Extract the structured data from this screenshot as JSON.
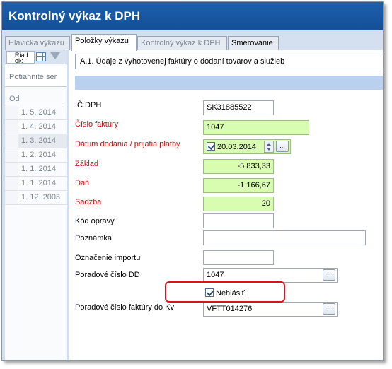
{
  "window": {
    "title": "Kontrolný výkaz k DPH"
  },
  "tabs": [
    {
      "label": "Hlavička výkazu"
    },
    {
      "label": "Položky výkazu"
    },
    {
      "label": "Kontrolný výkaz k DPH"
    },
    {
      "label": "Smerovanie"
    }
  ],
  "left_panel": {
    "row_button_label": "Riad\nok:",
    "grid_icon": "grid-icon",
    "filter_icon": "filter-icon",
    "drag_hint": "Potiahnite ser",
    "column_header": "Od",
    "rows": [
      "1. 5. 2014",
      "1. 4. 2014",
      "1. 3. 2014",
      "1. 2. 2014",
      "1. 1. 2014",
      "1. 1. 2014",
      "1. 12. 2003"
    ],
    "selected_row": 2
  },
  "form": {
    "section": "A.1. Údaje z vyhotovenej faktúry o dodaní tovarov a služieb",
    "fields": {
      "ic_dph": {
        "label": "IČ DPH",
        "value": "SK31885522"
      },
      "cislo_faktury": {
        "label": "Číslo faktúry",
        "value": "1047"
      },
      "datum": {
        "label": "Dátum dodania / prijatia platby",
        "value": "20.03.2014",
        "checked": true
      },
      "zaklad": {
        "label": "Základ",
        "value": "-5 833,33"
      },
      "dan": {
        "label": "Daň",
        "value": "-1 166,67"
      },
      "sadzba": {
        "label": "Sadzba",
        "value": "20"
      },
      "kod_opravy": {
        "label": "Kód opravy",
        "value": ""
      },
      "poznamka": {
        "label": "Poznámka",
        "value": ""
      },
      "oznacenie_importu": {
        "label": "Označenie importu",
        "value": ""
      },
      "poradove_dd": {
        "label": "Poradové číslo DD",
        "value": "1047"
      },
      "nehlasit": {
        "label": "Nehlásiť",
        "checked": true
      },
      "poradove_faktury_kv": {
        "label": "Poradové číslo faktúry do Kv",
        "value": "VFTT014276"
      }
    },
    "ellipsis_label": "...",
    "colors": {
      "required_label": "#d21010",
      "required_field": "#d8fcb0",
      "highlight": "#e0101a",
      "title_bar": "#1c5fae"
    }
  }
}
